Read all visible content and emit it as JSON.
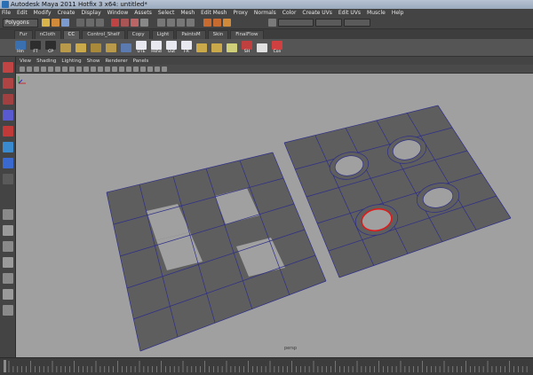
{
  "window": {
    "title": "Autodesk Maya 2011 Hotfix 3 x64: untitled*"
  },
  "menu": [
    "File",
    "Edit",
    "Modify",
    "Create",
    "Display",
    "Window",
    "Assets",
    "Select",
    "Mesh",
    "Edit Mesh",
    "Proxy",
    "Normals",
    "Color",
    "Create UVs",
    "Edit UVs",
    "Muscle",
    "Help"
  ],
  "status": {
    "mode": "Polygons"
  },
  "shelf": {
    "tabs": [
      "Fur",
      "nCloth",
      "CC",
      "Control_Shelf",
      "Copy",
      "Light",
      "PaintsM",
      "Skin",
      "FinalFlow"
    ],
    "active_tab": "CC",
    "buttons": [
      "Hm",
      "FT",
      "CP",
      "",
      "",
      "",
      "",
      "",
      "UTE",
      "Hshd",
      "Out",
      "FR",
      "",
      "",
      "",
      "SH",
      "",
      "Con"
    ]
  },
  "panel_menu": [
    "View",
    "Shading",
    "Lighting",
    "Show",
    "Renderer",
    "Panels"
  ],
  "viewport": {
    "camera": "persp"
  },
  "colors": {
    "viewport_bg": "#a0a0a0",
    "face": "#5e5e5e",
    "edge": "#2e2e8a",
    "selection": "#e01a1a"
  }
}
